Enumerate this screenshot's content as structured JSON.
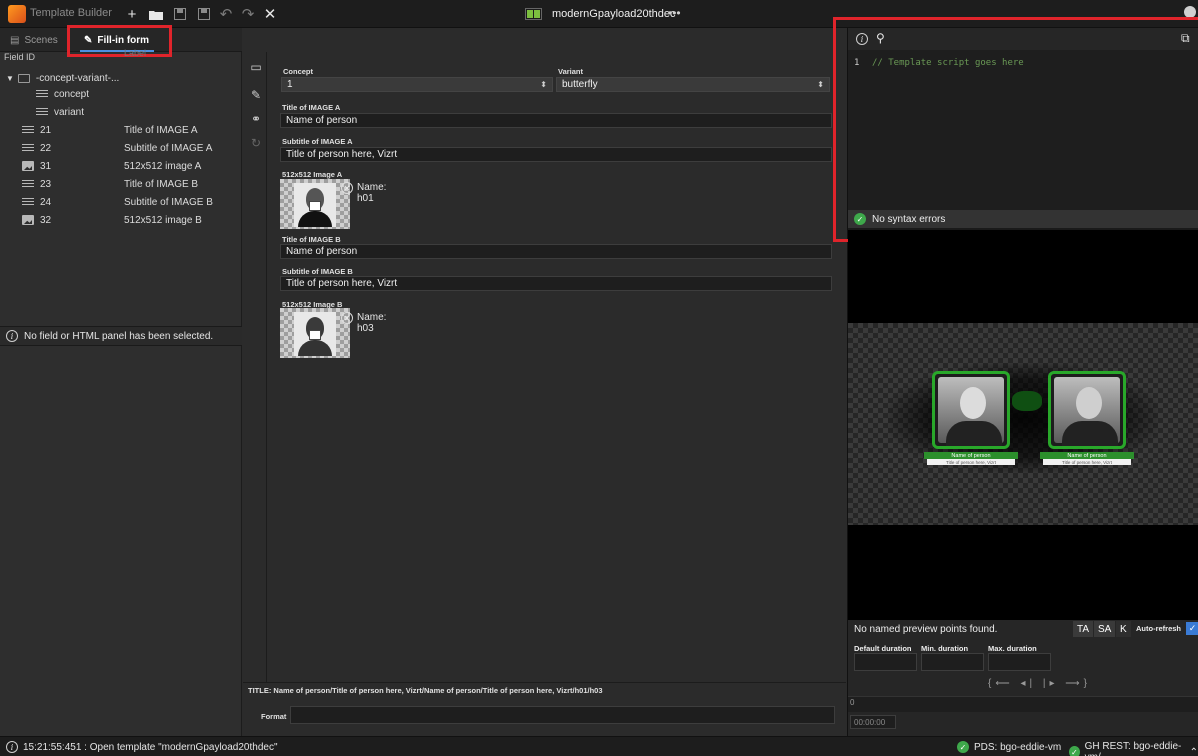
{
  "topbar": {
    "app_title": "Template Builder",
    "icons": [
      "add-icon",
      "folder-open-icon",
      "save-icon",
      "save-as-icon",
      "undo-icon",
      "redo-icon",
      "close-icon"
    ],
    "document_title": "modernGpayload20thdec",
    "more": "•••"
  },
  "left": {
    "tabs": {
      "scenes": "Scenes",
      "fillin": "Fill-in form"
    },
    "columns": {
      "field_id": "Field ID",
      "label": "Label"
    },
    "tree": [
      {
        "id": "-concept-variant-...",
        "label": "",
        "icon": "folder-icon",
        "indent": 0
      },
      {
        "id": "concept",
        "label": "",
        "icon": "text-lines-icon",
        "indent": 1
      },
      {
        "id": "variant",
        "label": "",
        "icon": "text-lines-icon",
        "indent": 1
      },
      {
        "id": "21",
        "label": "Title of IMAGE A",
        "icon": "text-lines-icon",
        "indent": 0
      },
      {
        "id": "22",
        "label": "Subtitle of IMAGE A",
        "icon": "text-lines-icon",
        "indent": 0
      },
      {
        "id": "31",
        "label": "512x512 image A",
        "icon": "image-icon",
        "indent": 0
      },
      {
        "id": "23",
        "label": "Title of IMAGE B",
        "icon": "text-lines-icon",
        "indent": 0
      },
      {
        "id": "24",
        "label": "Subtitle of IMAGE B",
        "icon": "text-lines-icon",
        "indent": 0
      },
      {
        "id": "32",
        "label": "512x512 image B",
        "icon": "image-icon",
        "indent": 0
      }
    ],
    "info": "No field or HTML panel has been selected."
  },
  "form": {
    "concept_label": "Concept",
    "concept_value": "1",
    "variant_label": "Variant",
    "variant_value": "butterfly",
    "title_a_label": "Title of IMAGE A",
    "title_a_value": "Name of person",
    "subtitle_a_label": "Subtitle of IMAGE A",
    "subtitle_a_value": "Title of person here, Vizrt",
    "image_a_label": "512x512 Image A",
    "image_a_name_label": "Name:",
    "image_a_name": "h01",
    "title_b_label": "Title of IMAGE B",
    "title_b_value": "Name of person",
    "subtitle_b_label": "Subtitle of IMAGE B",
    "subtitle_b_value": "Title of person here, Vizrt",
    "image_b_label": "512x512 Image B",
    "image_b_name_label": "Name:",
    "image_b_name": "h03",
    "title_summary": "TITLE: Name of person/Title of person here, Vizrt/Name of person/Title of person here, Vizrt/h01/h03",
    "format_label": "Format",
    "format_value": ""
  },
  "script": {
    "line_number": "1",
    "code": "// Template script goes here",
    "status": "No syntax errors"
  },
  "preview": {
    "card_a_name": "Name of person",
    "card_a_sub": "Title of person here, Vizrt",
    "card_b_name": "Name of person",
    "card_b_sub": "Title of person here, Vizrt",
    "note": "No named preview points found.",
    "buttons": {
      "ta": "TA",
      "sa": "SA",
      "k": "K"
    },
    "auto_refresh": "Auto-refresh",
    "auto_refresh_checked": true,
    "default_duration": "Default duration",
    "min_duration": "Min. duration",
    "max_duration": "Max. duration",
    "transport": "{⟵ ◂| |▸ ⟶}",
    "timeline_zero": "0",
    "timecode": "00:00:00"
  },
  "status": {
    "message": "15:21:55:451 : Open template \"modernGpayload20thdec\"",
    "pds": "PDS: bgo-eddie-vm",
    "gh_rest": "GH REST: bgo-eddie-vm/",
    "colors": {
      "ok": "#3ea84b",
      "highlight": "#e0242b",
      "accent": "#4a90e2"
    }
  }
}
